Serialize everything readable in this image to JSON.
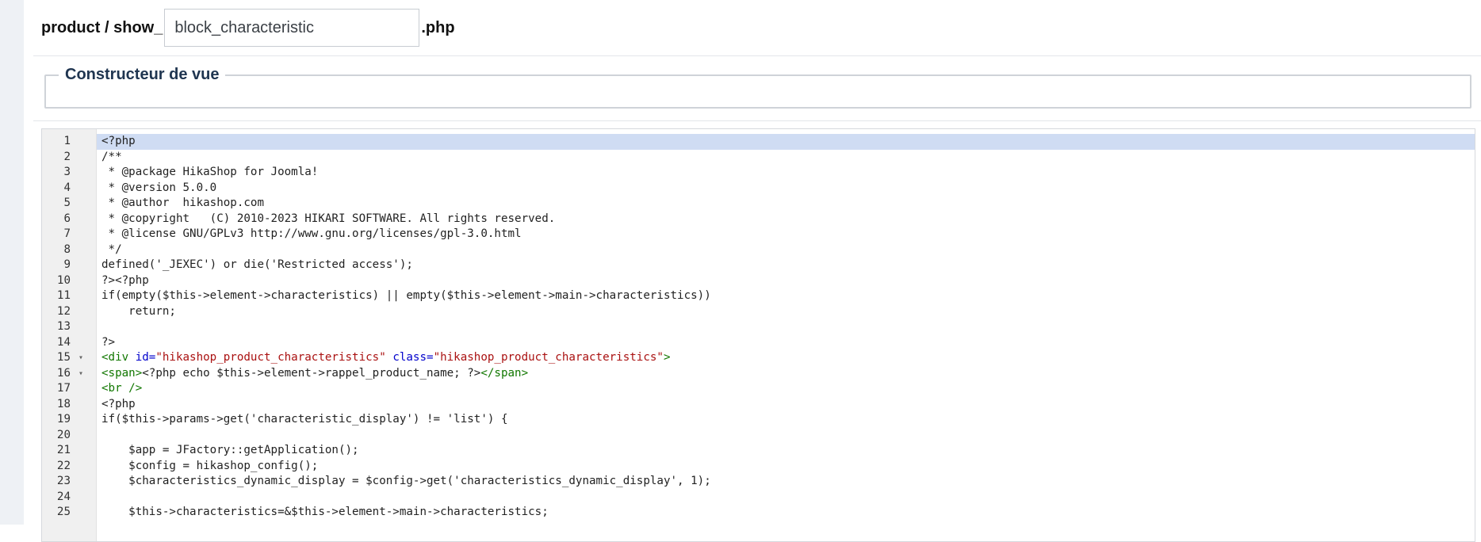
{
  "file_row": {
    "prefix": "product / show_",
    "input_value": "block_characteristic",
    "suffix": ".php"
  },
  "builder": {
    "legend": "Constructeur de vue"
  },
  "editor": {
    "active_line": 1,
    "lines": [
      {
        "num": "1",
        "fold": "",
        "segments": [
          {
            "t": "<?php",
            "c": ""
          }
        ]
      },
      {
        "num": "2",
        "fold": "",
        "segments": [
          {
            "t": "/**",
            "c": ""
          }
        ]
      },
      {
        "num": "3",
        "fold": "",
        "segments": [
          {
            "t": " * @package HikaShop for Joomla!",
            "c": ""
          }
        ]
      },
      {
        "num": "4",
        "fold": "",
        "segments": [
          {
            "t": " * @version 5.0.0",
            "c": ""
          }
        ]
      },
      {
        "num": "5",
        "fold": "",
        "segments": [
          {
            "t": " * @author  hikashop.com",
            "c": ""
          }
        ]
      },
      {
        "num": "6",
        "fold": "",
        "segments": [
          {
            "t": " * @copyright   (C) 2010-2023 HIKARI SOFTWARE. All rights reserved.",
            "c": ""
          }
        ]
      },
      {
        "num": "7",
        "fold": "",
        "segments": [
          {
            "t": " * @license GNU/GPLv3 http://www.gnu.org/licenses/gpl-3.0.html",
            "c": ""
          }
        ]
      },
      {
        "num": "8",
        "fold": "",
        "segments": [
          {
            "t": " */",
            "c": ""
          }
        ]
      },
      {
        "num": "9",
        "fold": "",
        "segments": [
          {
            "t": "defined('_JEXEC') or die('Restricted access');",
            "c": ""
          }
        ]
      },
      {
        "num": "10",
        "fold": "",
        "segments": [
          {
            "t": "?><?php",
            "c": ""
          }
        ]
      },
      {
        "num": "11",
        "fold": "",
        "segments": [
          {
            "t": "if(empty($this->element->characteristics) || empty($this->element->main->characteristics))",
            "c": ""
          }
        ]
      },
      {
        "num": "12",
        "fold": "",
        "segments": [
          {
            "t": "    return;",
            "c": ""
          }
        ]
      },
      {
        "num": "13",
        "fold": "",
        "segments": [
          {
            "t": "",
            "c": ""
          }
        ]
      },
      {
        "num": "14",
        "fold": "",
        "segments": [
          {
            "t": "?>",
            "c": ""
          }
        ]
      },
      {
        "num": "15",
        "fold": "▾",
        "segments": [
          {
            "t": "<div ",
            "c": "tag"
          },
          {
            "t": "id=",
            "c": "attr"
          },
          {
            "t": "\"hikashop_product_characteristics\"",
            "c": "str"
          },
          {
            "t": " ",
            "c": ""
          },
          {
            "t": "class=",
            "c": "attr"
          },
          {
            "t": "\"hikashop_product_characteristics\"",
            "c": "str"
          },
          {
            "t": ">",
            "c": "tag"
          }
        ]
      },
      {
        "num": "16",
        "fold": "▾",
        "segments": [
          {
            "t": "<span>",
            "c": "tag"
          },
          {
            "t": "<?php echo $this->element->rappel_product_name; ?>",
            "c": ""
          },
          {
            "t": "</span>",
            "c": "tag"
          }
        ]
      },
      {
        "num": "17",
        "fold": "",
        "segments": [
          {
            "t": "<br />",
            "c": "tag"
          }
        ]
      },
      {
        "num": "18",
        "fold": "",
        "segments": [
          {
            "t": "<?php",
            "c": ""
          }
        ]
      },
      {
        "num": "19",
        "fold": "",
        "segments": [
          {
            "t": "if($this->params->get('characteristic_display') != 'list') {",
            "c": ""
          }
        ]
      },
      {
        "num": "20",
        "fold": "",
        "segments": [
          {
            "t": "",
            "c": ""
          }
        ]
      },
      {
        "num": "21",
        "fold": "",
        "segments": [
          {
            "t": "    $app = JFactory::getApplication();",
            "c": ""
          }
        ]
      },
      {
        "num": "22",
        "fold": "",
        "segments": [
          {
            "t": "    $config = hikashop_config();",
            "c": ""
          }
        ]
      },
      {
        "num": "23",
        "fold": "",
        "segments": [
          {
            "t": "    $characteristics_dynamic_display = $config->get('characteristics_dynamic_display', 1);",
            "c": ""
          }
        ]
      },
      {
        "num": "24",
        "fold": "",
        "segments": [
          {
            "t": "",
            "c": ""
          }
        ]
      },
      {
        "num": "25",
        "fold": "",
        "segments": [
          {
            "t": "    $this->characteristics=&$this->element->main->characteristics;",
            "c": ""
          }
        ]
      }
    ]
  }
}
